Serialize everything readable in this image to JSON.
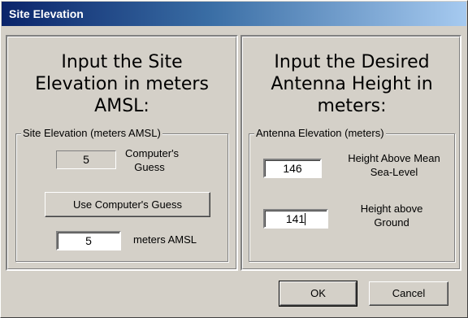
{
  "window": {
    "title": "Site Elevation"
  },
  "left": {
    "heading": "Input the Site Elevation in meters AMSL:",
    "group_label": "Site Elevation (meters AMSL)",
    "guess_value": "5",
    "guess_label": "Computer's Guess",
    "use_guess_button": "Use Computer's Guess",
    "elevation_value": "5",
    "elevation_unit": "meters AMSL"
  },
  "right": {
    "heading": "Input the Desired Antenna Height in meters:",
    "group_label": "Antenna Elevation (meters)",
    "msl_value": "146",
    "msl_label": "Height Above Mean Sea-Level",
    "ground_value": "141",
    "ground_label": "Height above Ground"
  },
  "buttons": {
    "ok": "OK",
    "cancel": "Cancel"
  }
}
